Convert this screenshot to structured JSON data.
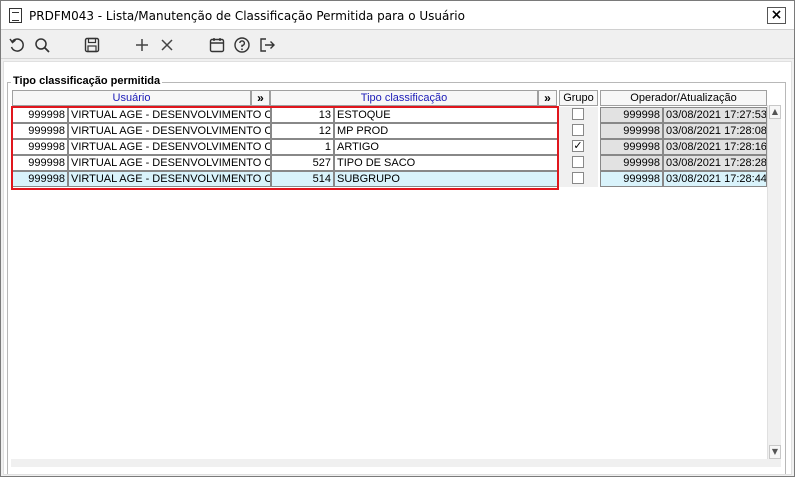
{
  "window": {
    "title": "PRDFM043 - Lista/Manutenção de Classificação Permitida para o Usuário",
    "close_label": "×"
  },
  "toolbar": {
    "buttons": [
      {
        "name": "refresh-icon"
      },
      {
        "name": "search-icon"
      },
      {
        "name": "save-icon"
      },
      {
        "name": "plus-icon"
      },
      {
        "name": "delete-icon"
      },
      {
        "name": "calendar-icon"
      },
      {
        "name": "help-icon"
      },
      {
        "name": "exit-icon"
      }
    ]
  },
  "group": {
    "label": "Tipo classificação permitida"
  },
  "grid": {
    "headers": {
      "usuario": "Usuário",
      "arrow1": "»",
      "tipo": "Tipo classificação",
      "arrow2": "»",
      "grupo": "Grupo",
      "operador": "Operador/Atualização"
    },
    "rows": [
      {
        "user_code": "999998",
        "user_name": "VIRTUAL AGE - DESENVOLVIMENTO CIAN",
        "tipo_code": "13",
        "tipo_name": "ESTOQUE",
        "grupo": false,
        "operador": "999998",
        "data": "03/08/2021 17:27:53"
      },
      {
        "user_code": "999998",
        "user_name": "VIRTUAL AGE - DESENVOLVIMENTO CIAN",
        "tipo_code": "12",
        "tipo_name": "MP PROD",
        "grupo": false,
        "operador": "999998",
        "data": "03/08/2021 17:28:08"
      },
      {
        "user_code": "999998",
        "user_name": "VIRTUAL AGE - DESENVOLVIMENTO CIAN",
        "tipo_code": "1",
        "tipo_name": "ARTIGO",
        "grupo": true,
        "operador": "999998",
        "data": "03/08/2021 17:28:16"
      },
      {
        "user_code": "999998",
        "user_name": "VIRTUAL AGE - DESENVOLVIMENTO CIAN",
        "tipo_code": "527",
        "tipo_name": "TIPO DE SACO",
        "grupo": false,
        "operador": "999998",
        "data": "03/08/2021 17:28:28"
      },
      {
        "user_code": "999998",
        "user_name": "VIRTUAL AGE - DESENVOLVIMENTO CIAN",
        "tipo_code": "514",
        "tipo_name": "SUBGRUPO",
        "grupo": false,
        "operador": "999998",
        "data": "03/08/2021 17:28:44"
      }
    ],
    "selected_row": 4,
    "check_mark": "✓"
  },
  "colors": {
    "header_text": "#1c1cb8",
    "selected_row": "#d9f3fb",
    "highlight_border": "#e0161d",
    "readonly_cell": "#e2e2e2"
  }
}
